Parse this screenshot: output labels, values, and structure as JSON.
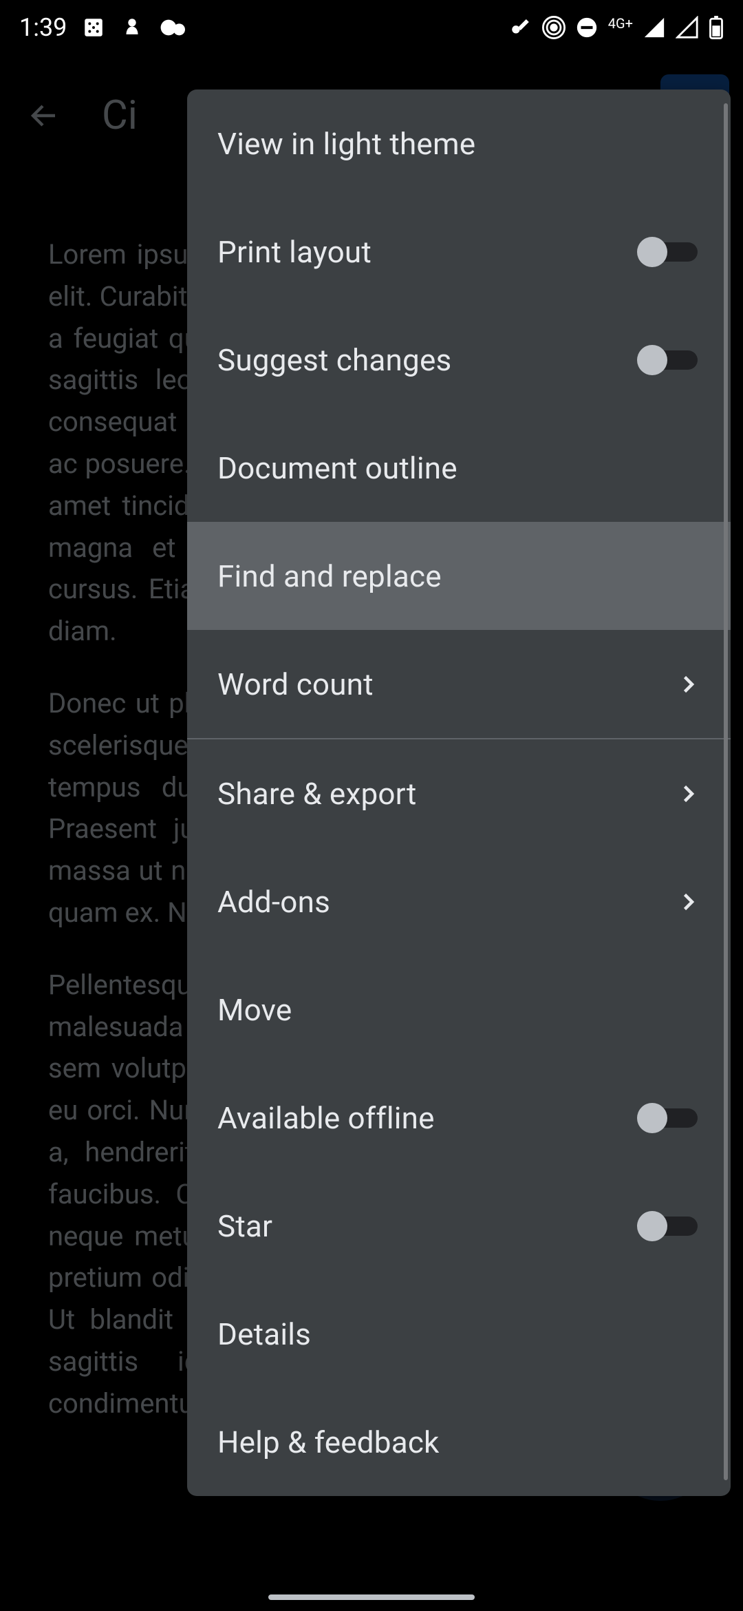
{
  "status": {
    "time": "1:39",
    "network_label": "4G+"
  },
  "header": {
    "title_partial": "Ci"
  },
  "document": {
    "para1": "Lorem ipsum dolor sit amet, consectetur adipiscing elit. Curabitur ullamcorper eros volutpat elit faucibus, a feugiat quam efficitur a. Phasellus gravida, metus sagittis leo eget eros tincidunt quam nulla vitae consequat eleifend. Sed dignissim imperdiet quam ac posuere. Etiam sit amet ipsum ut congue. Duis sit amet tincidunt enim, quis vehicula nibh eu aliquam magna et vulputate. Ut lobortis mattis enim ut cursus. Etiam at mi porttitor, mollis diam et, iaculis diam.",
    "para2": "Donec ut pharetra mi. Vivamus tempor eget tortor a scelerisque. Donec nulla gravida, lobortis lorem in, tempus dui. In auctor risus id ipsum dapibus. Praesent justo eu felis fringilla pulvinar. Proin at massa ut nisl tristique elementum commodo. Sed at quam ex. Nulla imperdiet sapien quam, quis tortor.",
    "para3": "Pellentesque habitant morbi tristique et netus et malesuada fames ac turpis. Quisque lacinia ex at sem volutpat, nec mauris vitae dolor feugiat aliquet eu orci. Nunc at libero justo. Vivamus mi, vel finibus a, hendrerit id leo. Aenean facilisis eget nulla in faucibus. Cras imperdiet, sapien ultrices tincidunt, neque metus vehicula eros, in tristique lacus, porta pretium odio et sagittis turpis. Nunc eu gravida nisi. Ut blandit tincidunt quam, varius elementum ante sagittis id. Maecenas pretium, enim nec condimentum"
  },
  "menu": {
    "view_light": "View in light theme",
    "print_layout": "Print layout",
    "suggest_changes": "Suggest changes",
    "document_outline": "Document outline",
    "find_replace": "Find and replace",
    "word_count": "Word count",
    "share_export": "Share & export",
    "addons": "Add-ons",
    "move": "Move",
    "available_offline": "Available offline",
    "star": "Star",
    "details": "Details",
    "help_feedback": "Help & feedback",
    "toggles": {
      "print_layout": false,
      "suggest_changes": false,
      "available_offline": false,
      "star": false
    }
  }
}
